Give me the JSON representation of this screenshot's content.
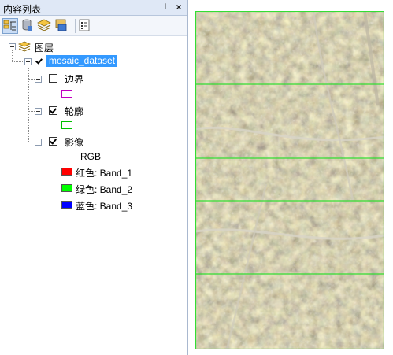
{
  "panel": {
    "title": "内容列表",
    "pin_glyph": "⊥",
    "close_glyph": "×"
  },
  "toolbar": {
    "buttons": [
      {
        "icon": "list-by-drawing-order-icon",
        "active": true
      },
      {
        "icon": "list-by-source-icon",
        "active": false
      },
      {
        "icon": "list-by-visibility-icon",
        "active": false
      },
      {
        "icon": "list-by-selection-icon",
        "active": false
      },
      {
        "icon": "options-icon",
        "active": false
      }
    ]
  },
  "tree": {
    "root_label": "图层",
    "dataset_label": "mosaic_dataset",
    "layers": [
      {
        "label": "边界",
        "checked": false,
        "swatch_border": "#c000c0",
        "swatch_fill": "#ffffff"
      },
      {
        "label": "轮廓",
        "checked": true,
        "swatch_border": "#00c000",
        "swatch_fill": "#ffffff"
      },
      {
        "label": "影像",
        "checked": true
      }
    ],
    "image_legend": {
      "composite": "RGB",
      "bands": [
        {
          "label": "红色:    Band_1",
          "color": "#ff0000"
        },
        {
          "label": "绿色: Band_2",
          "color": "#00ff00"
        },
        {
          "label": "蓝色:   Band_3",
          "color": "#0000ff"
        }
      ]
    }
  },
  "map": {
    "footprint_color": "#33dd33"
  }
}
